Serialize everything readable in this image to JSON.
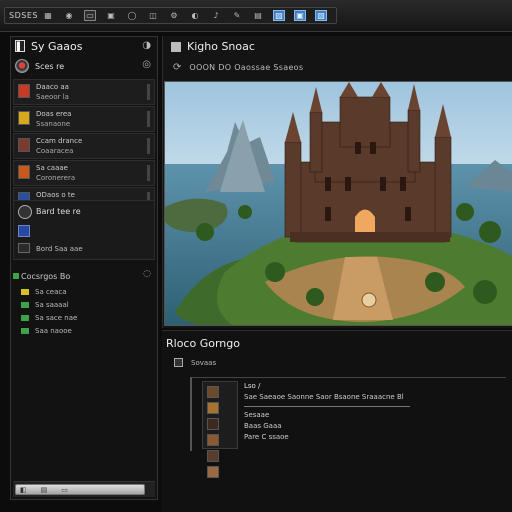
{
  "toolbar": {
    "app_label": "SDSES",
    "buttons": [
      {
        "icon": "grid-icon",
        "glyph": "▦",
        "style": "plain"
      },
      {
        "icon": "eye-icon",
        "glyph": "◉",
        "style": "plain"
      },
      {
        "icon": "folder-icon",
        "glyph": "▭",
        "style": "boxed"
      },
      {
        "icon": "save-icon",
        "glyph": "▣",
        "style": "plain"
      },
      {
        "icon": "circle-icon",
        "glyph": "◯",
        "style": "plain"
      },
      {
        "icon": "layers-icon",
        "glyph": "◫",
        "style": "plain"
      },
      {
        "icon": "settings-icon",
        "glyph": "⚙",
        "style": "plain"
      },
      {
        "icon": "toggle-icon",
        "glyph": "◐",
        "style": "plain"
      },
      {
        "icon": "music-icon",
        "glyph": "♪",
        "style": "plain"
      },
      {
        "icon": "pen-icon",
        "glyph": "✎",
        "style": "plain"
      },
      {
        "icon": "copy-icon",
        "glyph": "▤",
        "style": "plain"
      },
      {
        "icon": "image-icon",
        "glyph": "▨",
        "style": "blue"
      },
      {
        "icon": "monitor-icon",
        "glyph": "▣",
        "style": "blue"
      },
      {
        "icon": "export-icon",
        "glyph": "▧",
        "style": "blue"
      }
    ]
  },
  "left_panel": {
    "title": "Sy Gaaos",
    "title_icon": "app-icon",
    "user": {
      "name": "Sces re"
    },
    "items": [
      {
        "line1": "Daaco aa",
        "line2": "Saeoor la",
        "thumb_color": "#c93a24"
      },
      {
        "line1": "Doas erea",
        "line2": "Ssanaone",
        "thumb_color": "#d9a91c"
      },
      {
        "line1": "Ccam drance",
        "line2": "Coaaracea",
        "thumb_color": "#7a3a30"
      },
      {
        "line1": "Sa caaae",
        "line2": "Coronerera",
        "thumb_color": "#c8581c"
      },
      {
        "line1": "ODaos o te",
        "line2": "",
        "thumb_color": "#2b4fa0"
      }
    ],
    "user_block": {
      "name": "Bard tee re",
      "sub": "Bord Saa aae"
    },
    "categories": {
      "title": "Cocsrgos Bo",
      "rows": [
        {
          "label": "Sa ceaca",
          "color": "#d8c020"
        },
        {
          "label": "Sa saaaal",
          "color": "#3ea24a"
        },
        {
          "label": "Sa sace nae",
          "color": "#3ea24a"
        },
        {
          "label": "Saa naooe",
          "color": "#3ea24a"
        }
      ]
    },
    "footer_buttons": [
      "◧",
      "▤",
      "▭"
    ]
  },
  "main": {
    "title": "Kigho Snoac",
    "sub_text": "OOON  DO  Oaossae  Ssaeos"
  },
  "detail": {
    "title": "Rloco Gorngo",
    "sub_text": "Sovaas",
    "lines": [
      "Lso /",
      "Sae  Saeaoe  Saonne  Saor  Bsaone Sraaacne  Bl",
      "Sesaae",
      "Baas  Gaaa",
      "Pare  C ssaoe"
    ]
  }
}
